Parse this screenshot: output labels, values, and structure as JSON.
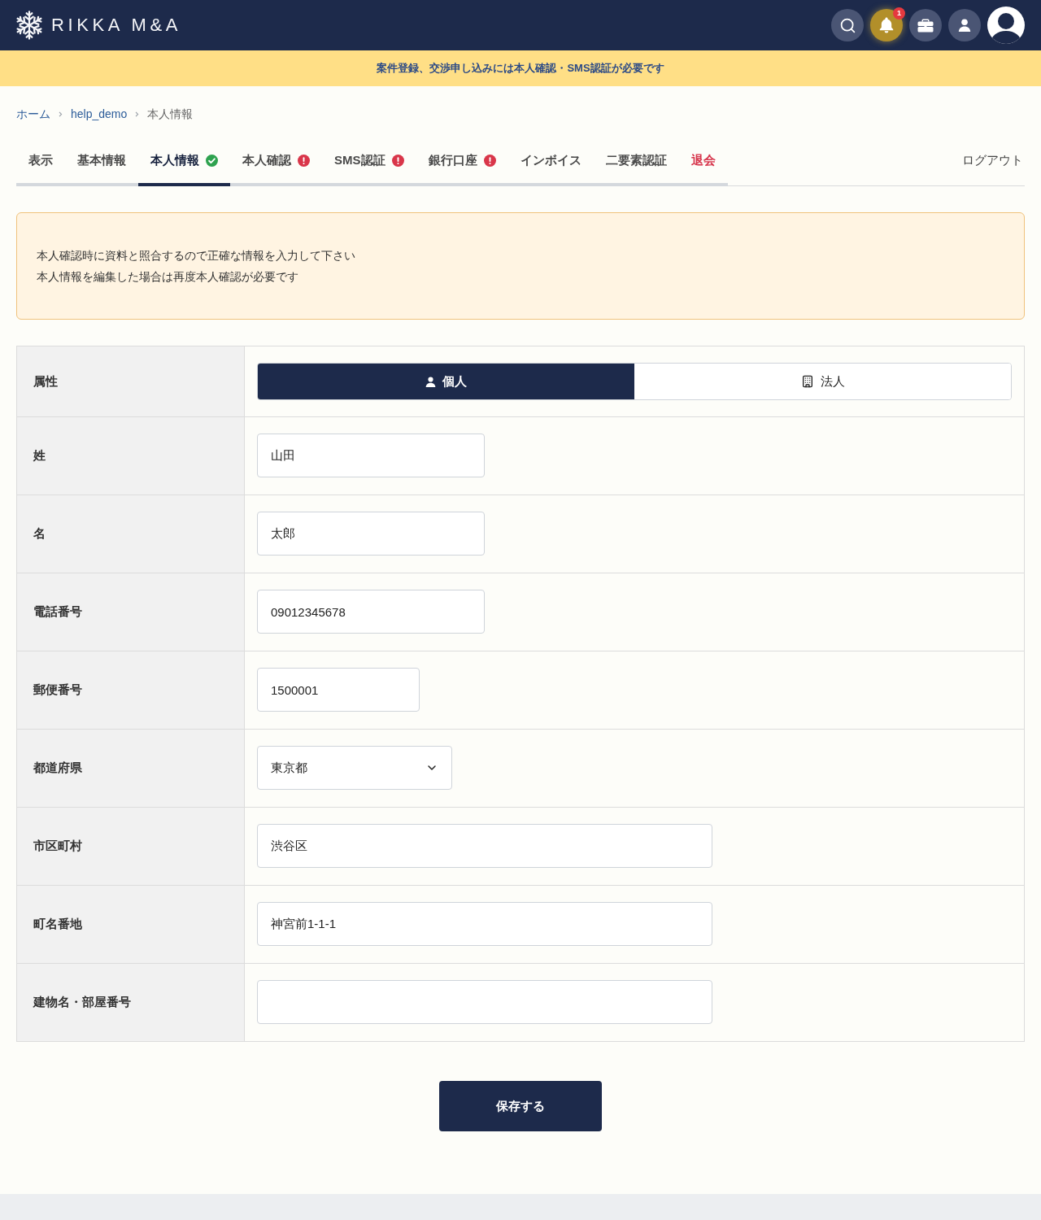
{
  "header": {
    "logo": "RIKKA M&A",
    "notification_count": "1"
  },
  "banner": {
    "text": "案件登録、交渉申し込みには本人確認・SMS認証が必要です"
  },
  "breadcrumb": [
    {
      "label": "ホーム",
      "current": false
    },
    {
      "label": "help_demo",
      "current": false
    },
    {
      "label": "本人情報",
      "current": true
    }
  ],
  "tabs": [
    {
      "label": "表示",
      "selected": false,
      "kind": "plain"
    },
    {
      "label": "基本情報",
      "selected": false,
      "kind": "plain"
    },
    {
      "label": "本人情報",
      "selected": true,
      "kind": "complete"
    },
    {
      "label": "本人確認",
      "selected": false,
      "kind": "required"
    },
    {
      "label": "SMS認証",
      "selected": false,
      "kind": "required"
    },
    {
      "label": "銀行口座",
      "selected": false,
      "kind": "required"
    },
    {
      "label": "インボイス",
      "selected": false,
      "kind": "plain"
    },
    {
      "label": "二要素認証",
      "selected": false,
      "kind": "plain"
    },
    {
      "label": "退会",
      "selected": false,
      "kind": "danger"
    }
  ],
  "logout": "ログアウト",
  "notice": {
    "lines": [
      "本人確認時に資料と照合するので正確な情報を入力して下さい",
      "本人情報を編集した場合は再度本人確認が必要です"
    ]
  },
  "form": {
    "rows": [
      {
        "label": "属性",
        "kind": "segmented",
        "options": [
          {
            "label": "個人",
            "selected": true
          },
          {
            "label": "法人",
            "selected": false
          }
        ]
      },
      {
        "label": "姓",
        "kind": "short-text",
        "value": "山田"
      },
      {
        "label": "名",
        "kind": "short-text",
        "value": "太郎"
      },
      {
        "label": "電話番号",
        "kind": "short-text",
        "value": "09012345678"
      },
      {
        "label": "郵便番号",
        "kind": "postal-code",
        "value": "1500001"
      },
      {
        "label": "都道府県",
        "kind": "select",
        "value": "東京都"
      },
      {
        "label": "市区町村",
        "kind": "long-text",
        "value": "渋谷区"
      },
      {
        "label": "町名番地",
        "kind": "long-text",
        "value": "神宮前1-1-1"
      },
      {
        "label": "建物名・部屋番号",
        "kind": "long-text"
      }
    ]
  },
  "save_button": "保存する"
}
